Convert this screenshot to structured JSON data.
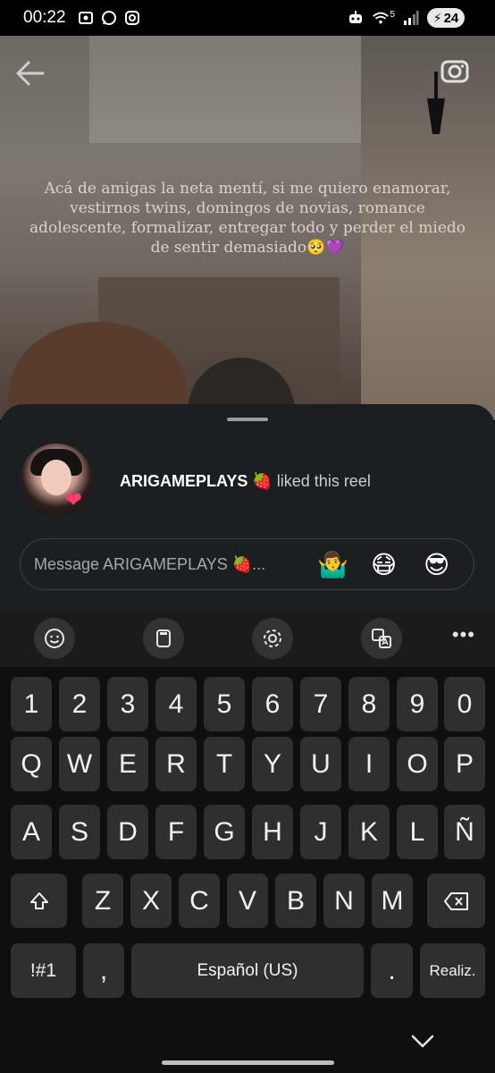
{
  "status_bar": {
    "time": "00:22",
    "battery": "24",
    "network": "5",
    "left_icons": [
      "screen-record-icon",
      "whatsapp-icon",
      "instagram-icon"
    ],
    "right_icons": [
      "android-robot-icon",
      "wifi-icon",
      "signal-icon",
      "battery-icon"
    ]
  },
  "reel": {
    "caption": "Acá de amigas la neta mentí, si me quiero enamorar, vestirnos twins, domingos de novias, romance adolescente, formalizar, entregar todo y perder el miedo de sentir demasiado🥺💜",
    "back_icon": "back-arrow-icon",
    "camera_icon": "camera-icon"
  },
  "sheet": {
    "username": "ARIGAMEPLAYS 🍓",
    "liked_text": " liked this reel",
    "message_placeholder": "Message ARIGAMEPLAYS 🍓...",
    "quick_emojis": [
      "🤷‍♂️",
      "😷",
      "😎"
    ],
    "avatar_badge": "❤"
  },
  "keyboard": {
    "toolbar": [
      "emoji-icon",
      "clipboard-icon",
      "settings-icon",
      "translate-icon",
      "more-icon"
    ],
    "more_label": "•••",
    "row_numbers": [
      "1",
      "2",
      "3",
      "4",
      "5",
      "6",
      "7",
      "8",
      "9",
      "0"
    ],
    "row1": [
      "Q",
      "W",
      "E",
      "R",
      "T",
      "Y",
      "U",
      "I",
      "O",
      "P"
    ],
    "row2": [
      "A",
      "S",
      "D",
      "F",
      "G",
      "H",
      "J",
      "K",
      "L",
      "Ñ"
    ],
    "row3": [
      "Z",
      "X",
      "C",
      "V",
      "B",
      "N",
      "M"
    ],
    "symbols_label": "!#1",
    "comma_label": ",",
    "space_label": "Español (US)",
    "period_label": ".",
    "action_label": "Realiz."
  },
  "colors": {
    "sheet_bg": "#1c1f22",
    "key_bg": "#2f2f2f",
    "keyboard_bg": "#0f0f0f",
    "heart": "#ff3b6b"
  }
}
